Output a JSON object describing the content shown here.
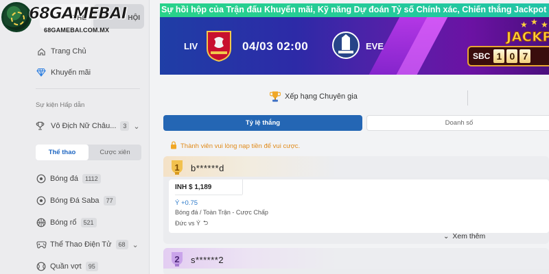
{
  "sidebar": {
    "top_tabs": [
      "THỂ",
      "HỘI"
    ],
    "logo": {
      "text": "68GAMEBAI",
      "url": "68GAMEBAI.COM.MX"
    },
    "menu": [
      {
        "label": "Trang Chủ",
        "icon": "home-icon"
      },
      {
        "label": "Khuyến mãi",
        "icon": "diamond-icon"
      }
    ],
    "section_label": "Sự kiện Hấp dẫn",
    "event": {
      "label": "Vô Địch Nữ Châu...",
      "count": "3"
    },
    "sport_tabs": [
      "Thể thao",
      "Cược xiên"
    ],
    "sports": [
      {
        "label": "Bóng đá",
        "count": "1112",
        "icon": "soccer-ball-icon"
      },
      {
        "label": "Bóng Đá Saba",
        "count": "77",
        "icon": "soccer-ball-icon"
      },
      {
        "label": "Bóng rổ",
        "count": "521",
        "icon": "basketball-icon"
      },
      {
        "label": "Thể Thao Điện Tử",
        "count": "68",
        "icon": "esports-icon"
      },
      {
        "label": "Quần vợt",
        "count": "95",
        "icon": "tennis-icon"
      }
    ]
  },
  "banner": {
    "ticker": "Sự hồi hộp của Trận đấu Khuyến mãi, Kỹ năng Dự đoán Tỷ số Chính xác, Chiến thắng Jackpot",
    "home_team": "LIV",
    "away_team": "EVE",
    "match_time": "04/03 02:00",
    "jackpot_title": "JACKPOT",
    "jackpot_label": "SBC",
    "jackpot_digits": [
      "1",
      "0",
      "7"
    ]
  },
  "main": {
    "expert_label": "Xếp hạng Chuyên gia",
    "tabs": [
      "Tỷ lệ thắng",
      "Doanh số"
    ],
    "notice": "Thành viên vui lòng nạp tiền để vui cược.",
    "cards": [
      {
        "rank": "1",
        "username": "b******d",
        "amount": "INH $ 1,189",
        "odds": "Ý +0.75",
        "market": "Bóng đá / Toàn Trận - Cược Chấp",
        "teams": "Đức vs Ý",
        "more": "Xem thêm"
      },
      {
        "rank": "2",
        "username": "s******2"
      }
    ]
  },
  "colors": {
    "accent_blue": "#2466b4",
    "ticker_green": "#28d28a",
    "notice_orange": "#e08a1a",
    "odds_blue": "#2b79c9"
  }
}
